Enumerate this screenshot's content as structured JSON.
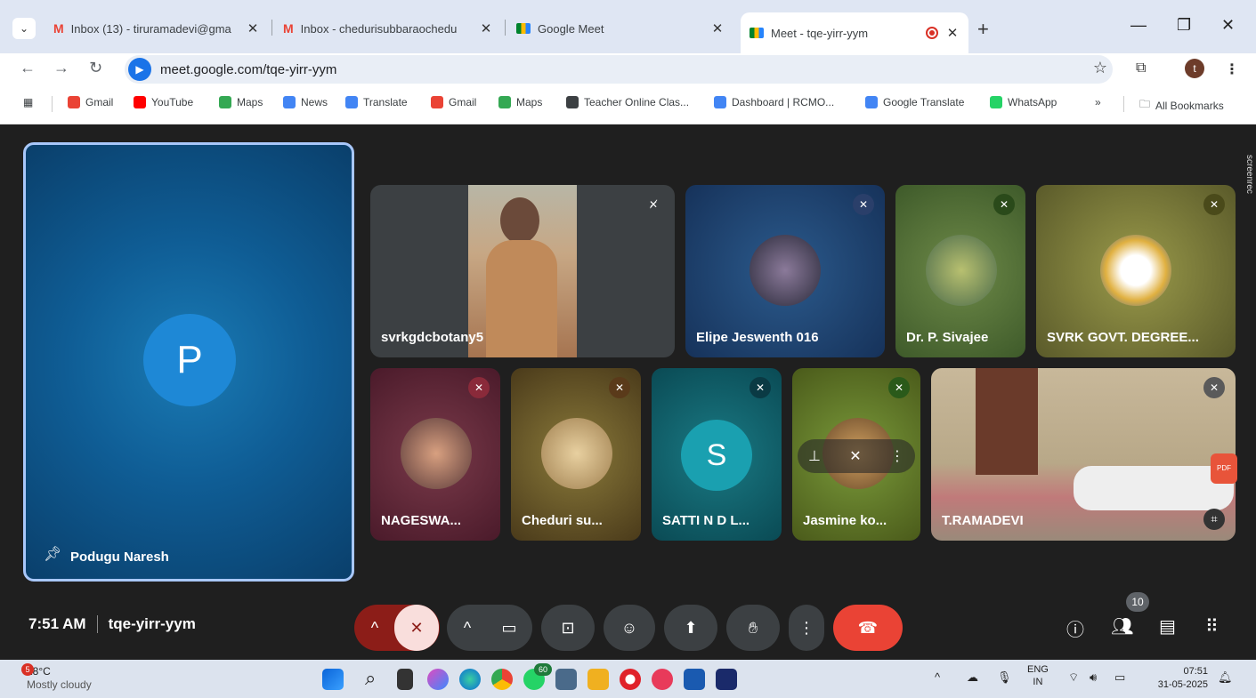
{
  "tabs": [
    {
      "title": "Inbox (13) - tiruramadevi@gma",
      "icon": "gmail-icon"
    },
    {
      "title": "Inbox - chedurisubbaraochedu",
      "icon": "gmail-icon"
    },
    {
      "title": "Google Meet",
      "icon": "meet-icon"
    },
    {
      "title": "Meet - tqe-yirr-yym",
      "icon": "meet-icon",
      "active": true
    }
  ],
  "address": {
    "url": "meet.google.com/tqe-yirr-yym",
    "profile_initial": "t"
  },
  "bookmarks": [
    {
      "label": "Gmail",
      "color": "#ea4335"
    },
    {
      "label": "YouTube",
      "color": "#ff0000"
    },
    {
      "label": "Maps",
      "color": "#34a853"
    },
    {
      "label": "News",
      "color": "#4285f4"
    },
    {
      "label": "Translate",
      "color": "#4285f4"
    },
    {
      "label": "Gmail",
      "color": "#ea4335"
    },
    {
      "label": "Maps",
      "color": "#34a853"
    },
    {
      "label": "Teacher Online Clas...",
      "color": "#3c4043"
    },
    {
      "label": "Dashboard | RCMO...",
      "color": "#4285f4"
    },
    {
      "label": "Google Translate",
      "color": "#4285f4"
    },
    {
      "label": "WhatsApp",
      "color": "#25d366"
    }
  ],
  "bookmarks_more": "»",
  "all_bookmarks": "All Bookmarks",
  "pinned": {
    "initial": "P",
    "name": "Podugu Naresh"
  },
  "participants": [
    {
      "name": "svrkgdcbotany5",
      "bg": "#3c4043"
    },
    {
      "name": "Elipe Jeswenth 016",
      "bg": "#1c3a63"
    },
    {
      "name": "Dr. P. Sivajee",
      "bg": "#5a7a3a"
    },
    {
      "name": "SVRK GOVT. DEGREE...",
      "bg": "#7d7f3a"
    },
    {
      "name": "NAGESWA...",
      "bg": "#6e2a3a"
    },
    {
      "name": "Cheduri su...",
      "bg": "#6d5a2a"
    },
    {
      "name": "SATTI N D L...",
      "bg": "#0f5a64",
      "initial": "S"
    },
    {
      "name": "Jasmine ko...",
      "bg": "#5a7a22"
    },
    {
      "name": "T.RAMADEVI",
      "bg": "#8a7a60"
    }
  ],
  "meeting": {
    "time": "7:51 AM",
    "code": "tqe-yirr-yym",
    "people_count": "10"
  },
  "taskbar": {
    "temp": "28°C",
    "weather": "Mostly cloudy",
    "weather_badge": "5",
    "lang_top": "ENG",
    "lang_bottom": "IN",
    "time": "07:51",
    "date": "31-05-2025",
    "chrome_badge": "60"
  },
  "screenrec_label": "screenrec"
}
